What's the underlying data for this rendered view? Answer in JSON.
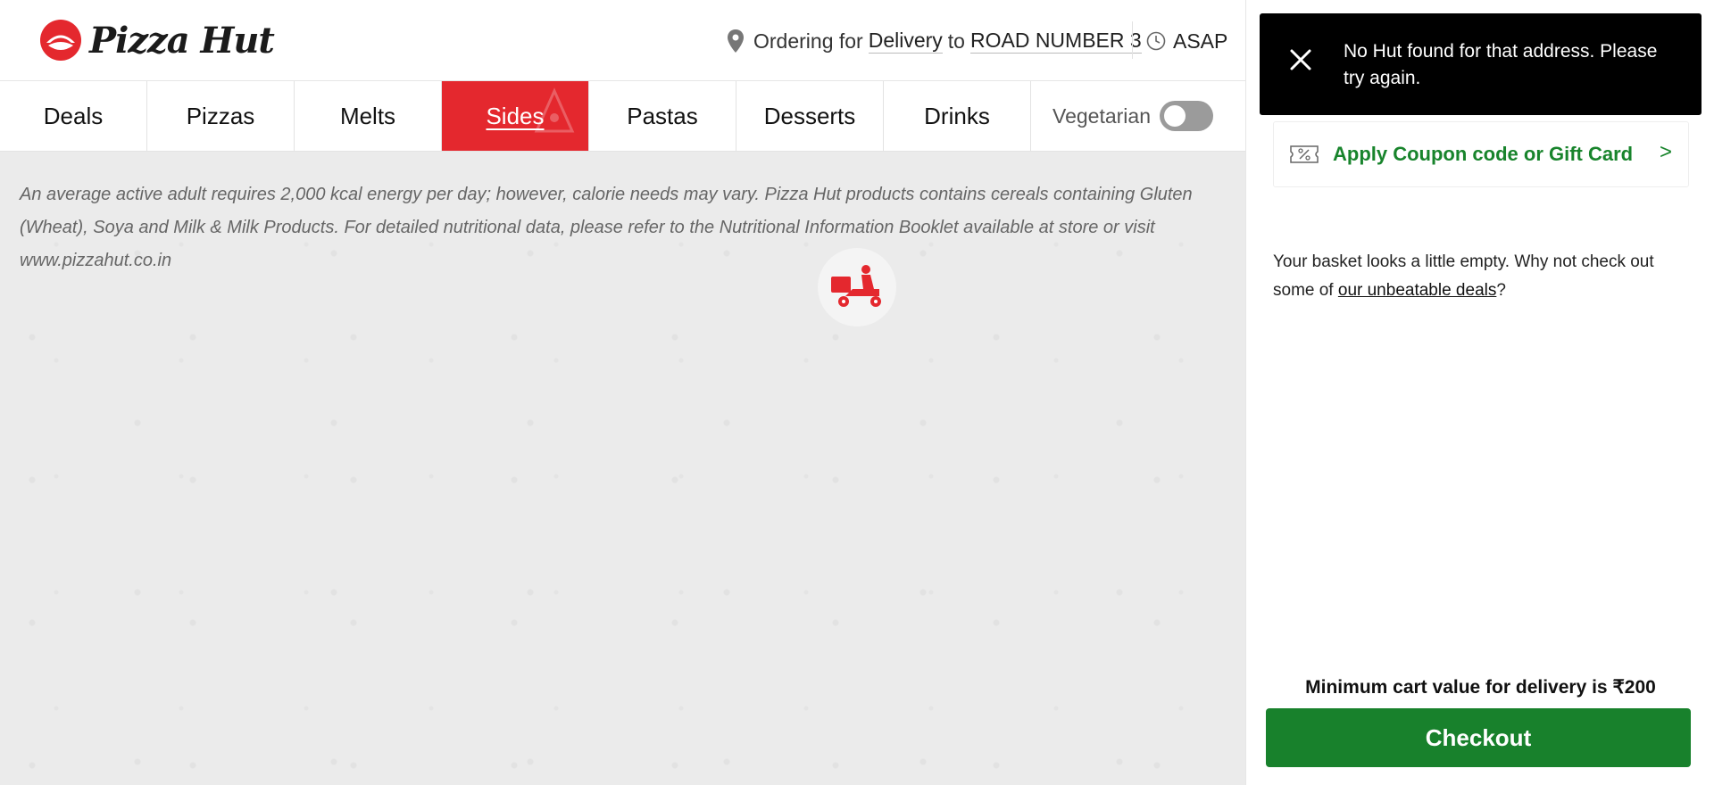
{
  "header": {
    "brand": "Pizza Hut",
    "order_prefix": "Ordering for",
    "order_mode": "Delivery",
    "order_to": "to",
    "address": "ROAD NUMBER 3",
    "time": "ASAP"
  },
  "nav": {
    "items": [
      {
        "label": "Deals"
      },
      {
        "label": "Pizzas"
      },
      {
        "label": "Melts"
      },
      {
        "label": "Sides"
      },
      {
        "label": "Pastas"
      },
      {
        "label": "Desserts"
      },
      {
        "label": "Drinks"
      }
    ],
    "active": "Sides",
    "vegetarian_label": "Vegetarian",
    "vegetarian_on": false
  },
  "main": {
    "disclaimer": "An average active adult requires 2,000 kcal energy per day; however, calorie needs may vary. Pizza Hut products contains cereals containing Gluten (Wheat), Soya and Milk & Milk Products. For detailed nutritional data, please refer to the Nutritional Information Booklet available at store or visit www.pizzahut.co.in"
  },
  "toast": {
    "message": "No Hut found for that address. Please try again."
  },
  "basket": {
    "coupon_label": "Apply Coupon code or Gift Card",
    "coupon_arrow": ">",
    "empty_prefix": "Your basket looks a little empty. Why not check out some of ",
    "empty_link": "our unbeatable deals",
    "empty_suffix": "?",
    "min_cart": "Minimum cart value for delivery is ₹200",
    "checkout_label": "Checkout"
  },
  "colors": {
    "brand_red": "#e4282e",
    "action_green": "#18812c",
    "toast_bg": "#000000"
  }
}
